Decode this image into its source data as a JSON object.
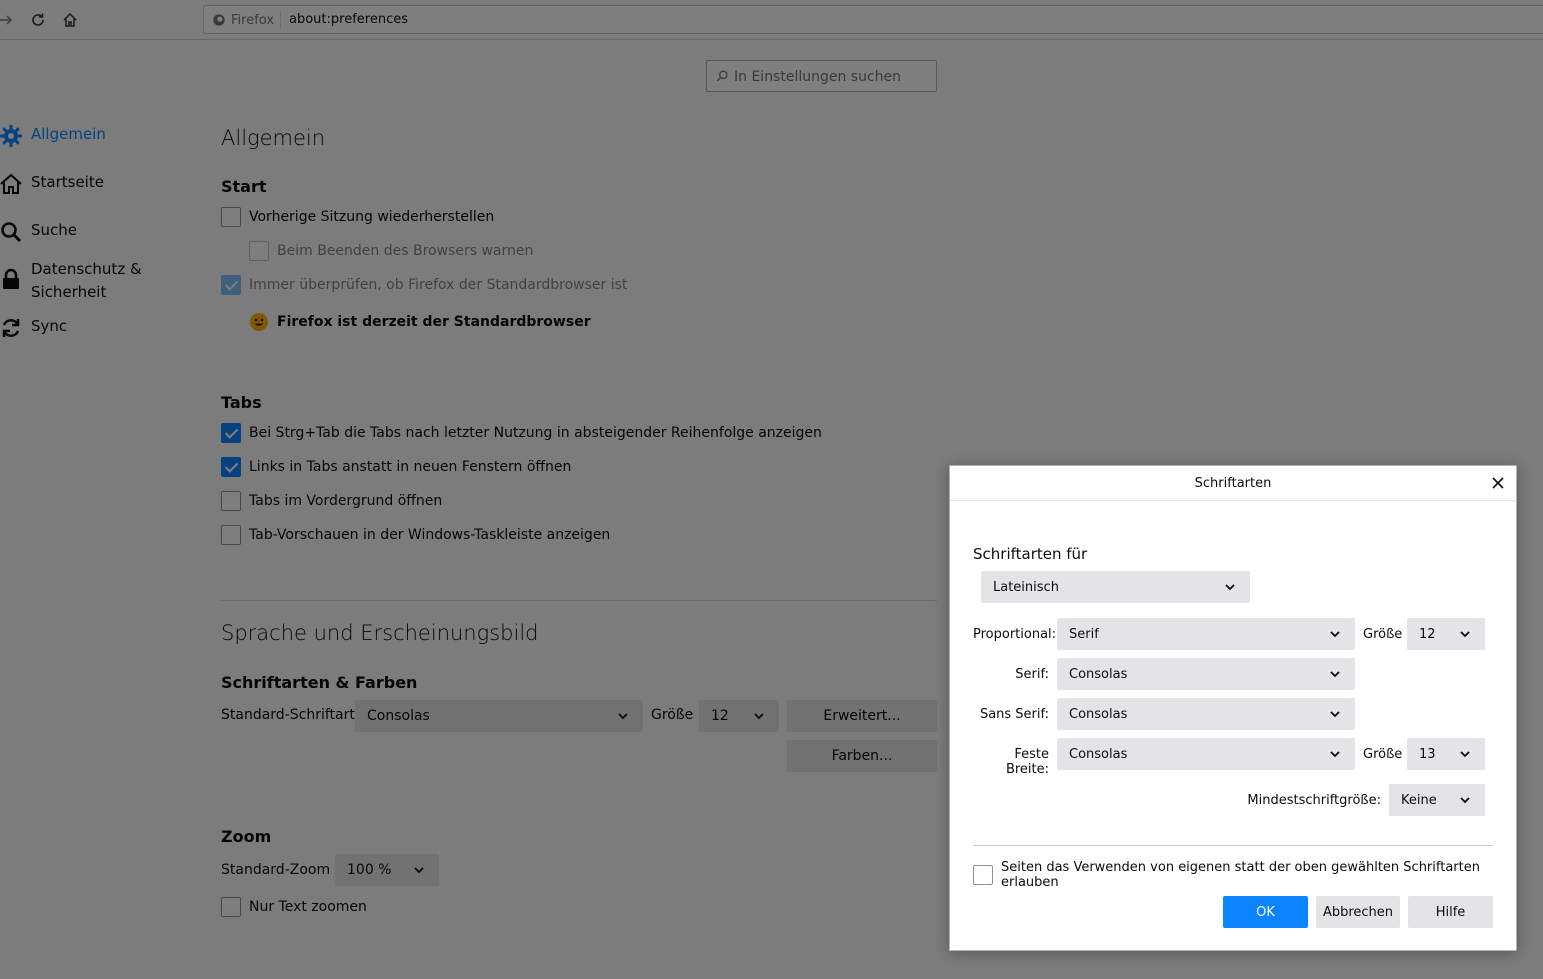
{
  "toolbar": {
    "identity_label": "Firefox",
    "url": "about:preferences"
  },
  "search": {
    "placeholder": "In Einstellungen suchen"
  },
  "sidebar": {
    "items": [
      {
        "label": "Allgemein",
        "icon": "gear-icon",
        "active": true
      },
      {
        "label": "Startseite",
        "icon": "home-icon"
      },
      {
        "label": "Suche",
        "icon": "search-icon"
      },
      {
        "label": "Datenschutz & Sicherheit",
        "icon": "lock-icon"
      },
      {
        "label": "Sync",
        "icon": "sync-icon"
      }
    ]
  },
  "main": {
    "title": "Allgemein",
    "start": {
      "heading": "Start",
      "restore_session": "Vorherige Sitzung wiederherstellen",
      "warn_on_quit": "Beim Beenden des Browsers warnen",
      "check_default": "Immer überprüfen, ob Firefox der Standardbrowser ist",
      "default_status": "Firefox ist derzeit der Standardbrowser"
    },
    "tabs": {
      "heading": "Tabs",
      "ctrl_tab": "Bei Strg+Tab die Tabs nach letzter Nutzung in absteigender Reihenfolge anzeigen",
      "links_in_tabs": "Links in Tabs anstatt in neuen Fenstern öffnen",
      "foreground": "Tabs im Vordergrund öffnen",
      "taskbar_previews": "Tab-Vorschauen in der Windows-Taskleiste anzeigen"
    },
    "language": {
      "title": "Sprache und Erscheinungsbild",
      "fonts_heading": "Schriftarten & Farben",
      "default_font_label": "Standard-Schriftart",
      "default_font_value": "Consolas",
      "size_label": "Größe",
      "size_value": "12",
      "advanced_button": "Erweitert...",
      "colors_button": "Farben..."
    },
    "zoom": {
      "heading": "Zoom",
      "default_zoom_label": "Standard-Zoom",
      "default_zoom_value": "100 %",
      "text_only": "Nur Text zoomen"
    }
  },
  "dialog": {
    "title": "Schriftarten",
    "fonts_for_label": "Schriftarten für",
    "language_value": "Lateinisch",
    "proportional_label": "Proportional:",
    "proportional_value": "Serif",
    "size_label": "Größe",
    "proportional_size": "12",
    "serif_label": "Serif:",
    "serif_value": "Consolas",
    "sans_serif_label": "Sans Serif:",
    "sans_serif_value": "Consolas",
    "monospace_label": "Feste Breite:",
    "monospace_value": "Consolas",
    "monospace_size": "13",
    "min_size_label": "Mindestschriftgröße:",
    "min_size_value": "Keine",
    "allow_pages_label": "Seiten das Verwenden von eigenen statt der oben gewählten Schriftarten erlauben",
    "ok_button": "OK",
    "cancel_button": "Abbrechen",
    "help_button": "Hilfe"
  },
  "colors": {
    "accent": "#0a84ff"
  }
}
